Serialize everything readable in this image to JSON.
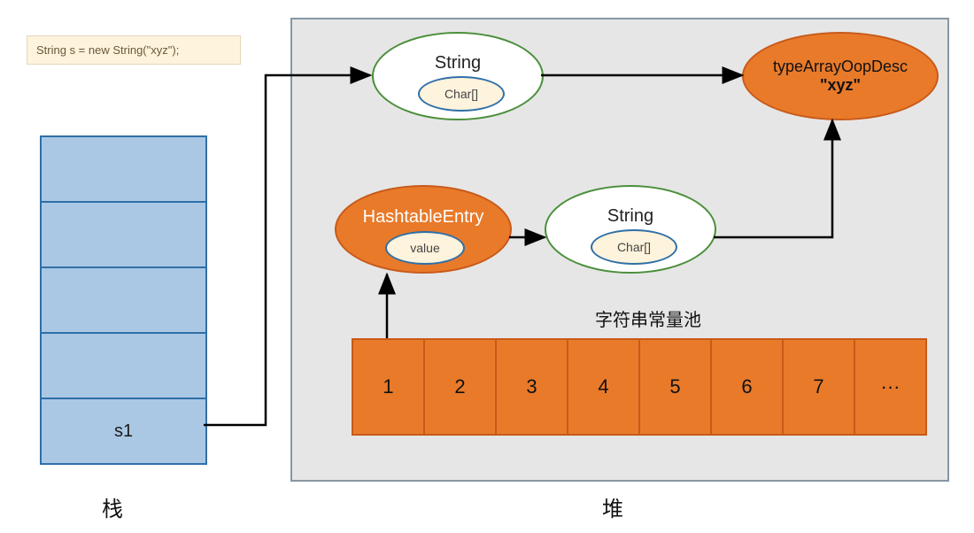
{
  "code": "String s = new String(\"xyz\");",
  "stack": {
    "label": "栈",
    "cells": [
      "",
      "",
      "",
      "",
      "s1"
    ]
  },
  "heap": {
    "label": "堆"
  },
  "string_obj_1": {
    "title": "String",
    "inner": "Char[]"
  },
  "string_obj_2": {
    "title": "String",
    "inner": "Char[]"
  },
  "typearray": {
    "title": "typeArrayOopDesc",
    "value": "\"xyz\""
  },
  "hashtable": {
    "title": "HashtableEntry",
    "inner": "value"
  },
  "pool": {
    "title": "字符串常量池",
    "cells": [
      "1",
      "2",
      "3",
      "4",
      "5",
      "6",
      "7",
      "···"
    ]
  }
}
